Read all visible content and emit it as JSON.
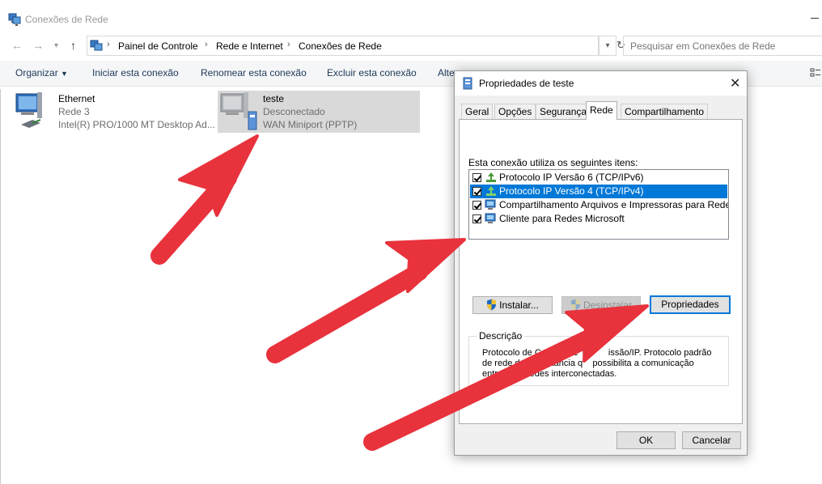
{
  "window": {
    "title": "Conexões de Rede"
  },
  "address_bar": {
    "breadcrumbs": [
      "Painel de Controle",
      "Rede e Internet",
      "Conexões de Rede"
    ],
    "search_placeholder": "Pesquisar em Conexões de Rede"
  },
  "command_bar": {
    "organize": "Organizar",
    "items": [
      "Iniciar esta conexão",
      "Renomear esta conexão",
      "Excluir esta conexão",
      "Alte"
    ]
  },
  "connections": [
    {
      "name": "Ethernet",
      "status": "Rede 3",
      "device": "Intel(R) PRO/1000 MT Desktop Ad..."
    },
    {
      "name": "teste",
      "status": "Desconectado",
      "device": "WAN Miniport (PPTP)"
    }
  ],
  "dialog": {
    "title": "Propriedades de teste",
    "tabs": [
      "Geral",
      "Opções",
      "Segurança",
      "Rede",
      "Compartilhamento"
    ],
    "active_tab": "Rede",
    "list_label": "Esta conexão utiliza os seguintes itens:",
    "items": [
      {
        "label": "Protocolo IP Versão 6 (TCP/IPv6)",
        "checked": true
      },
      {
        "label": "Protocolo IP Versão 4 (TCP/IPv4)",
        "checked": true
      },
      {
        "label": "Compartilhamento Arquivos e Impressoras para Redes Mi...",
        "checked": true
      },
      {
        "label": "Cliente para Redes Microsoft",
        "checked": true
      }
    ],
    "buttons": {
      "install": "Instalar...",
      "uninstall": "Desinstalar",
      "properties": "Propriedades"
    },
    "description_title": "Descrição",
    "description_lines": [
      "Protocolo de Co           e Tra      issão/IP. Protocolo padrão",
      "de rede d           stância q    possibilita a comunicação",
      "entr         s redes interconectadas."
    ],
    "ok": "OK",
    "cancel": "Cancelar"
  },
  "colors": {
    "selection": "#0078d7",
    "annotation_arrow": "#e8323c"
  }
}
